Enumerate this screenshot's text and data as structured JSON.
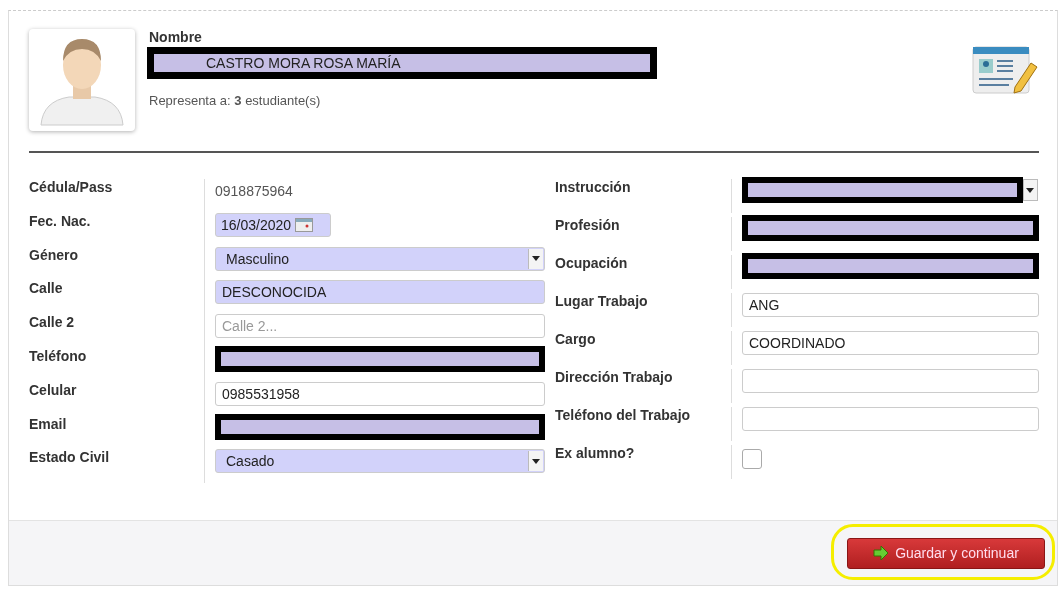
{
  "header": {
    "name_label": "Nombre",
    "name_value": "CASTRO MORA ROSA MARÍA",
    "name_redacted": true,
    "represents": "Representa a: **3** estudiante(s)"
  },
  "left_fields": [
    {
      "label": "Cédula/Pass",
      "kind": "static",
      "value": "0918875964"
    },
    {
      "label": "Fec. Nac.",
      "kind": "date",
      "value": "16/03/2020",
      "tinted": true
    },
    {
      "label": "Género",
      "kind": "select",
      "value": "Masculino",
      "tinted": true
    },
    {
      "label": "Calle",
      "kind": "input",
      "value": "DESCONOCIDA",
      "tinted": true
    },
    {
      "label": "Calle 2",
      "kind": "input",
      "placeholder": "Calle 2...",
      "tinted": false
    },
    {
      "label": "Teléfono",
      "kind": "redacted"
    },
    {
      "label": "Celular",
      "kind": "input",
      "value": "0985531958",
      "tinted": false
    },
    {
      "label": "Email",
      "kind": "redacted"
    },
    {
      "label": "Estado Civil",
      "kind": "select",
      "value": "Casado",
      "tinted": true
    }
  ],
  "right_fields": [
    {
      "label": "Instrucción",
      "kind": "redacted-select"
    },
    {
      "label": "Profesión",
      "kind": "redacted"
    },
    {
      "label": "Ocupación",
      "kind": "redacted"
    },
    {
      "label": "Lugar Trabajo",
      "kind": "input",
      "value": "ANG",
      "tinted": false
    },
    {
      "label": "Cargo",
      "kind": "input",
      "value": "COORDINADO",
      "tinted": false
    },
    {
      "label": "Dirección Trabajo",
      "kind": "input",
      "tinted": false
    },
    {
      "label": "Teléfono del Trabajo",
      "kind": "input",
      "tinted": false
    },
    {
      "label": "Ex alumno?",
      "kind": "checkbox",
      "checked": false
    }
  ],
  "footer": {
    "button": "Guardar y continuar",
    "highlighted": true
  }
}
